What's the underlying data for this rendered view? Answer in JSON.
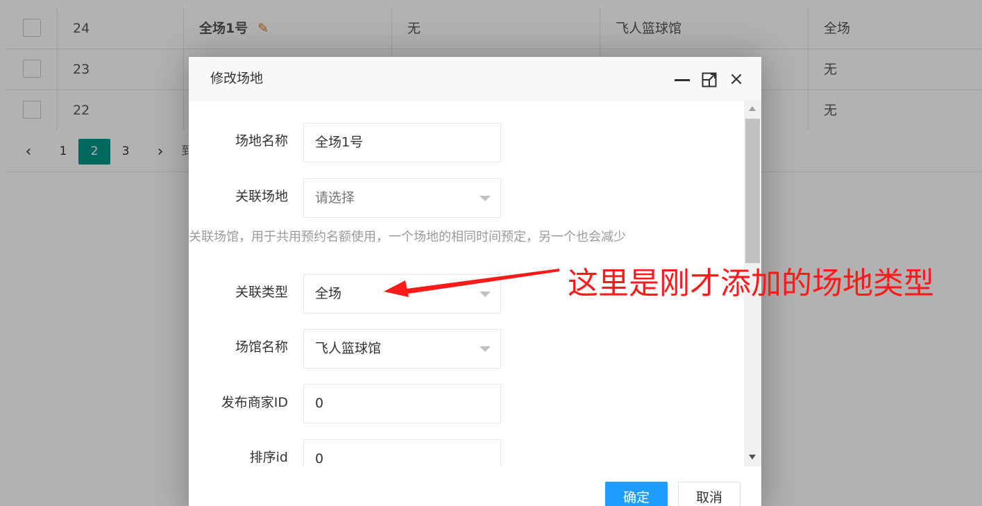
{
  "table": {
    "rows": [
      {
        "id": "24",
        "name": "全场1号",
        "desc": "无",
        "venue": "飞人篮球馆",
        "type": "全场"
      },
      {
        "id": "23",
        "name": "",
        "desc": "",
        "venue": "",
        "type": "无"
      },
      {
        "id": "22",
        "name": "",
        "desc": "",
        "venue": "",
        "type": "无"
      }
    ],
    "edit_icon": "pencil-icon"
  },
  "pager": {
    "prev": "‹",
    "pages": [
      "1",
      "2",
      "3"
    ],
    "current": "2",
    "next": "›",
    "goto_text": "到"
  },
  "modal": {
    "title": "修改场地",
    "fields": {
      "venue_name_label": "场地名称",
      "venue_name_value": "全场1号",
      "related_venue_label": "关联场地",
      "related_venue_placeholder": "请选择",
      "hint": "关联场馆，用于共用预约名额使用，一个场地的相同时间预定，另一个也会减少",
      "related_type_label": "关联类型",
      "related_type_value": "全场",
      "hall_name_label": "场馆名称",
      "hall_name_value": "飞人篮球馆",
      "merchant_id_label": "发布商家ID",
      "merchant_id_value": "0",
      "sort_id_label": "排序id",
      "sort_id_value": "0"
    },
    "buttons": {
      "ok": "确定",
      "cancel": "取消"
    },
    "controls": {
      "minimize": "minimize-icon",
      "maximize": "maximize-icon",
      "close": "×"
    }
  },
  "annotation": {
    "text": "这里是刚才添加的场地类型",
    "color": "#ff1a1a"
  },
  "colors": {
    "accent": "#009688",
    "primary_button": "#1e9fff"
  }
}
